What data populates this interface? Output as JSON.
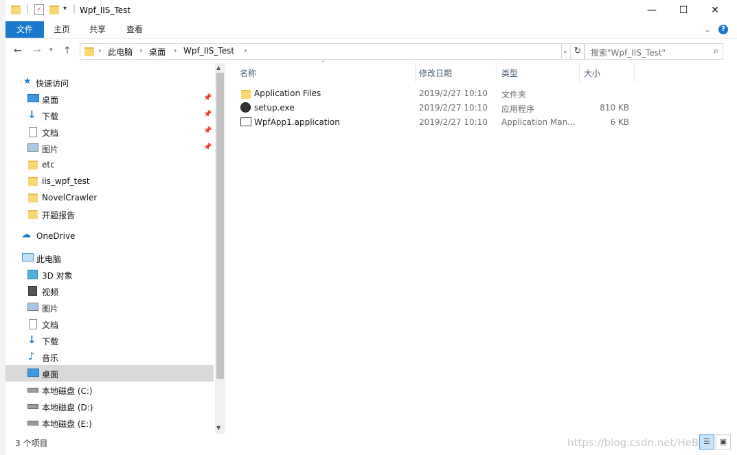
{
  "window": {
    "title": "Wpf_IIS_Test",
    "minimize": "—",
    "maximize": "☐",
    "close": "✕"
  },
  "ribbon": {
    "tabs": [
      "文件",
      "主页",
      "共享",
      "查看"
    ],
    "collapse": "⌄",
    "help": "?"
  },
  "address": {
    "crumbs": [
      "此电脑",
      "桌面",
      "Wpf_IIS_Test"
    ],
    "search_placeholder": "搜索\"Wpf_IIS_Test\""
  },
  "nav": {
    "items": [
      {
        "label": "快速访问",
        "icon": "star-icon"
      },
      {
        "label": "桌面",
        "icon": "desktop-icon",
        "pinned": true
      },
      {
        "label": "下载",
        "icon": "download-icon",
        "pinned": true
      },
      {
        "label": "文档",
        "icon": "document-icon",
        "pinned": true
      },
      {
        "label": "图片",
        "icon": "picture-icon",
        "pinned": true
      },
      {
        "label": "etc",
        "icon": "folder-icon"
      },
      {
        "label": "iis_wpf_test",
        "icon": "folder-icon"
      },
      {
        "label": "NovelCrawler",
        "icon": "folder-icon"
      },
      {
        "label": "开题报告",
        "icon": "folder-icon"
      },
      {
        "label": "OneDrive",
        "icon": "cloud-icon"
      },
      {
        "label": "此电脑",
        "icon": "computer-icon"
      },
      {
        "label": "3D 对象",
        "icon": "cube-icon"
      },
      {
        "label": "视频",
        "icon": "video-icon"
      },
      {
        "label": "图片",
        "icon": "picture-icon"
      },
      {
        "label": "文档",
        "icon": "document-icon"
      },
      {
        "label": "下载",
        "icon": "download-icon"
      },
      {
        "label": "音乐",
        "icon": "music-icon"
      },
      {
        "label": "桌面",
        "icon": "desktop-icon",
        "selected": true
      },
      {
        "label": "本地磁盘 (C:)",
        "icon": "drive-icon"
      },
      {
        "label": "本地磁盘 (D:)",
        "icon": "drive-icon"
      },
      {
        "label": "本地磁盘 (E:)",
        "icon": "drive-icon"
      }
    ]
  },
  "columns": {
    "name": "名称",
    "date": "修改日期",
    "type": "类型",
    "size": "大小"
  },
  "files": [
    {
      "name": "Application Files",
      "date": "2019/2/27 10:10",
      "type": "文件夹",
      "size": "",
      "icon": "folder-icon"
    },
    {
      "name": "setup.exe",
      "date": "2019/2/27 10:10",
      "type": "应用程序",
      "size": "810 KB",
      "icon": "setup-icon"
    },
    {
      "name": "WpfApp1.application",
      "date": "2019/2/27 10:10",
      "type": "Application Man...",
      "size": "6 KB",
      "icon": "application-manifest-icon"
    }
  ],
  "status": {
    "count": "3 个项目",
    "watermark": "https://blog.csdn.net/HeBiz"
  },
  "colors": {
    "accent": "#1979ca",
    "folder": "#f8d775",
    "selected": "#d9d9d9"
  }
}
